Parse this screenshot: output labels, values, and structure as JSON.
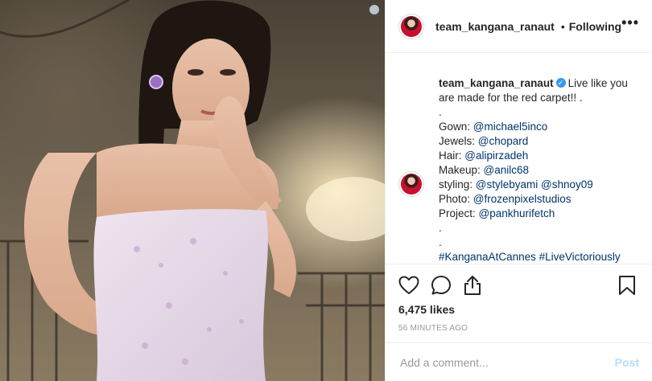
{
  "header": {
    "username": "team_kangana_ranaut",
    "separator": "•",
    "follow_status": "Following",
    "more": "•••"
  },
  "caption": {
    "username": "team_kangana_ranaut",
    "verified": "✓",
    "lines": [
      {
        "prefix": "Live like you are made for the red carpet!! .",
        "tags": []
      },
      {
        "prefix": ".",
        "tags": []
      },
      {
        "prefix": "Gown: ",
        "tags": [
          "@michael5inco"
        ]
      },
      {
        "prefix": "Jewels: ",
        "tags": [
          "@chopard"
        ]
      },
      {
        "prefix": "Hair: ",
        "tags": [
          "@alipirzadeh"
        ]
      },
      {
        "prefix": "Makeup: ",
        "tags": [
          "@anilc68"
        ]
      },
      {
        "prefix": "styling: ",
        "tags": [
          "@stylebyami",
          "@shnoy09"
        ]
      },
      {
        "prefix": "Photo: ",
        "tags": [
          "@frozenpixelstudios"
        ]
      },
      {
        "prefix": "Project: ",
        "tags": [
          "@pankhurifetch"
        ]
      },
      {
        "prefix": ".",
        "tags": []
      },
      {
        "prefix": ".",
        "tags": []
      },
      {
        "prefix": "",
        "tags": [
          "#KanganaAtCannes",
          "#LiveVictoriously"
        ]
      }
    ]
  },
  "actions": {
    "like_icon": "heart-icon",
    "comment_icon": "comment-icon",
    "share_icon": "share-icon",
    "save_icon": "bookmark-icon"
  },
  "likes": "6,475 likes",
  "timestamp": "56 MINUTES AGO",
  "comment_box": {
    "placeholder": "Add a comment...",
    "post_label": "Post"
  },
  "colors": {
    "link": "#003569",
    "verified": "#3897f0",
    "post_disabled": "#b2dffc"
  }
}
